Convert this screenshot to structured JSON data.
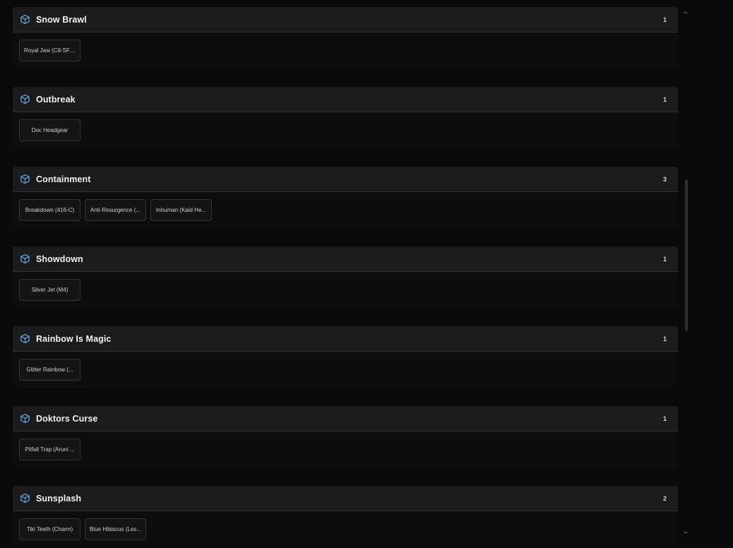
{
  "colors": {
    "accent_icon": "#5aa8e8",
    "header_bg": "#1b1b1b",
    "body_bg": "#0d0d0d"
  },
  "icon": "cube-icon",
  "sections": [
    {
      "title": "Snow Brawl",
      "count": "1",
      "items": [
        "Royal Jaw (C8-SFW)"
      ]
    },
    {
      "title": "Outbreak",
      "count": "1",
      "items": [
        "Doc Headgear"
      ]
    },
    {
      "title": "Containment",
      "count": "3",
      "items": [
        "Breakdown (416-C)",
        "Anti-Resurgence (...",
        "Inhuman (Kaid He..."
      ]
    },
    {
      "title": "Showdown",
      "count": "1",
      "items": [
        "Silver Jet (M4)"
      ]
    },
    {
      "title": "Rainbow Is Magic",
      "count": "1",
      "items": [
        "Glitter Rainbow (..."
      ]
    },
    {
      "title": "Doktors Curse",
      "count": "1",
      "items": [
        "Pitfall Trap (Aruni ..."
      ]
    },
    {
      "title": "Sunsplash",
      "count": "2",
      "items": [
        "Tiki Teeth (Charm)",
        "Blue Hibiscus (Les..."
      ]
    }
  ]
}
